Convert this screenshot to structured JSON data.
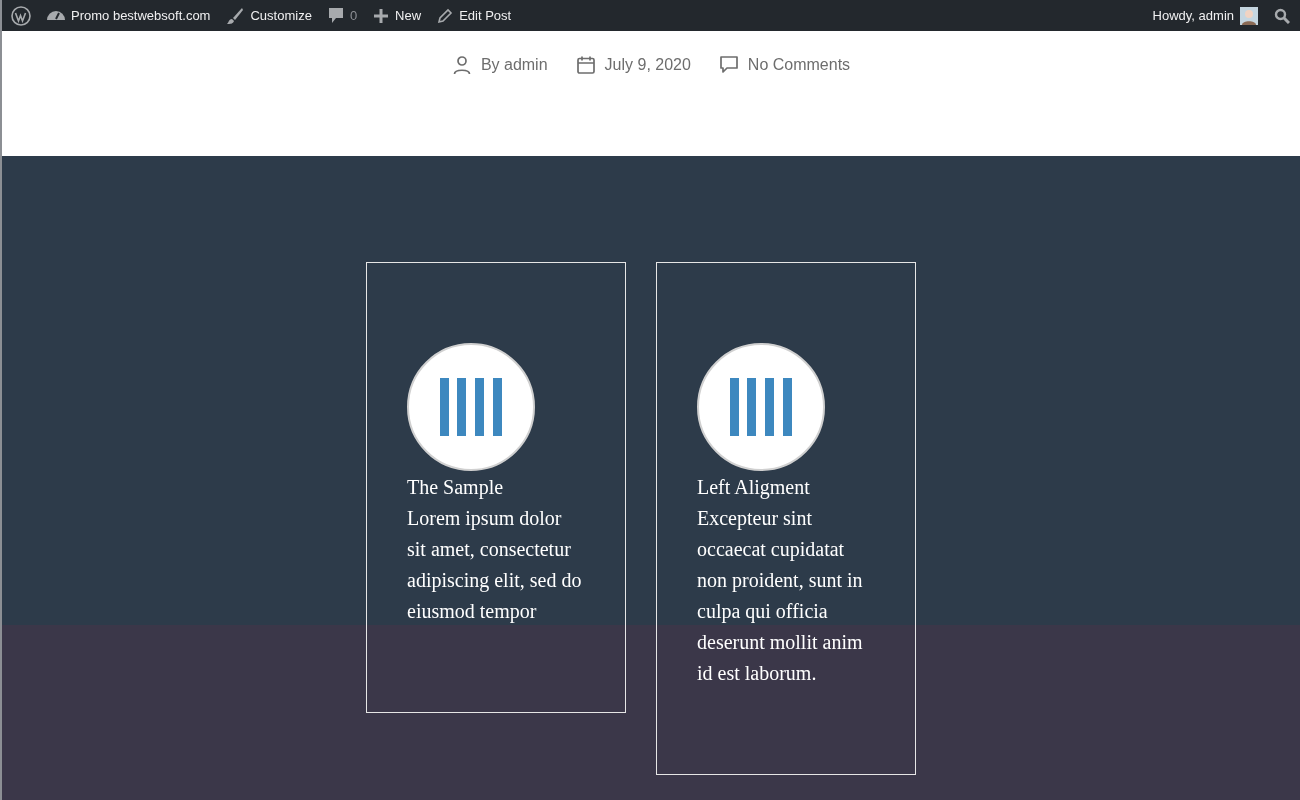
{
  "admin_bar": {
    "site": "Promo bestwebsoft.com",
    "customize": "Customize",
    "comments_count": "0",
    "new": "New",
    "edit": "Edit Post",
    "greeting": "Howdy, admin"
  },
  "post_meta": {
    "author": "By admin",
    "date": "July 9, 2020",
    "comments": "No Comments"
  },
  "cards": [
    {
      "title": "The Sample",
      "text": "Lorem ipsum dolor sit amet, consectetur adipiscing elit, sed do eiusmod tempor"
    },
    {
      "title": "Left Aligment",
      "text": "Excepteur sint occaecat cupidatat non proident, sunt in culpa qui officia deserunt mollit anim id est laborum."
    }
  ]
}
